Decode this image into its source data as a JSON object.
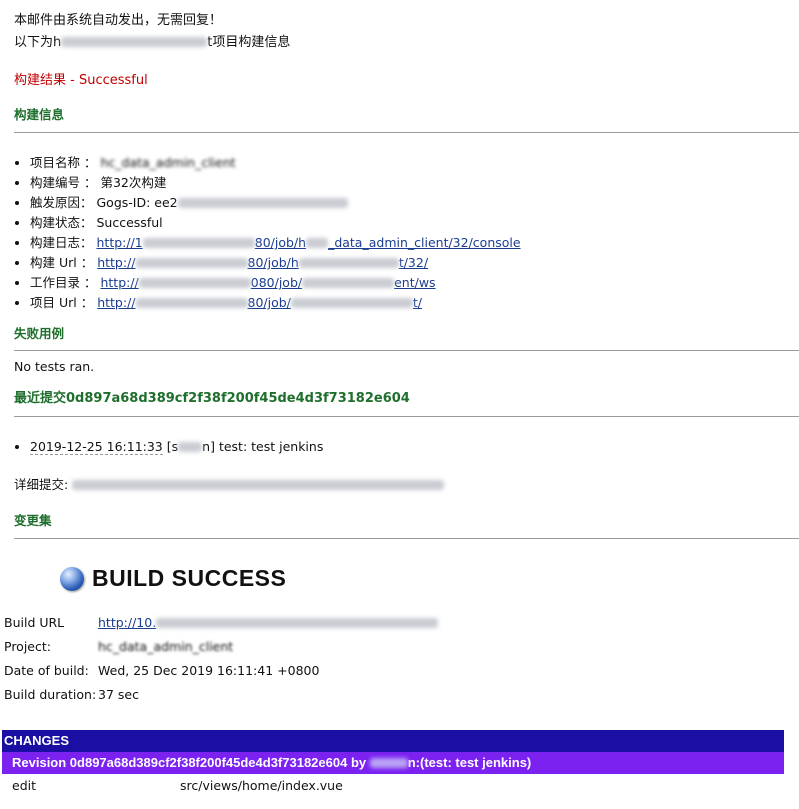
{
  "intro": {
    "line1": "本邮件由系统自动发出，无需回复！",
    "line2_prefix": "以下为h",
    "line2_suffix": "t项目构建信息"
  },
  "result": "构建结果 - Successful",
  "sections": {
    "build_info": "构建信息",
    "failed_cases": "失败用例",
    "latest_commit": "最近提交0d897a68d389cf2f38f200f45de4d3f73182e604",
    "changeset": "变更集"
  },
  "info_items": [
    {
      "label": "项目名称 ：",
      "value": "hc_data_admin_client"
    },
    {
      "label": "构建编号 ：",
      "value": "第32次构建"
    },
    {
      "label": "触发原因：",
      "value": "Gogs-ID: ee2"
    },
    {
      "label": "构建状态：",
      "value": "Successful"
    },
    {
      "label": "构建日志：",
      "link_a": "http://1",
      "link_b": "80/job/h",
      "link_c": "_data_admin_client/32/console"
    },
    {
      "label": "构建 Url ：",
      "link_a": "http://",
      "link_b": "80/job/h",
      "link_c": "t/32/"
    },
    {
      "label": "工作目录 ：",
      "link_a": "http://",
      "link_b": "080/job/",
      "link_c": "ent/ws"
    },
    {
      "label": "项目 Url ：",
      "link_a": "http://",
      "link_b": "80/job/",
      "link_c": "t/"
    }
  ],
  "no_tests": "No tests ran.",
  "commit_item": {
    "datetime": "2019-12-25 16:11:33",
    "author_prefix": "[s",
    "author_suffix": "n]",
    "message": "test: test jenkins"
  },
  "detail_label": "详细提交: ",
  "build": {
    "title": "BUILD SUCCESS",
    "rows": [
      {
        "key": "Build URL",
        "value": "http://10."
      },
      {
        "key": "Project:",
        "value": "hc_data_admin_client"
      },
      {
        "key": "Date of build:",
        "value": "Wed, 25 Dec 2019 16:11:41 +0800"
      },
      {
        "key": "Build duration:",
        "value": "37 sec"
      }
    ]
  },
  "changes": {
    "header": "CHANGES",
    "revision_prefix": "Revision 0d897a68d389cf2f38f200f45de4d3f73182e604 by ",
    "revision_suffix": "n:(test: test jenkins)",
    "row_action": "edit",
    "row_path": "src/views/home/index.vue"
  },
  "colors": {
    "result_red": "#c00000",
    "section_green": "#1f6f2c",
    "changes_header": "#1b0fa3",
    "revision_bar": "#7b22f0",
    "link": "#1a3d8f"
  }
}
